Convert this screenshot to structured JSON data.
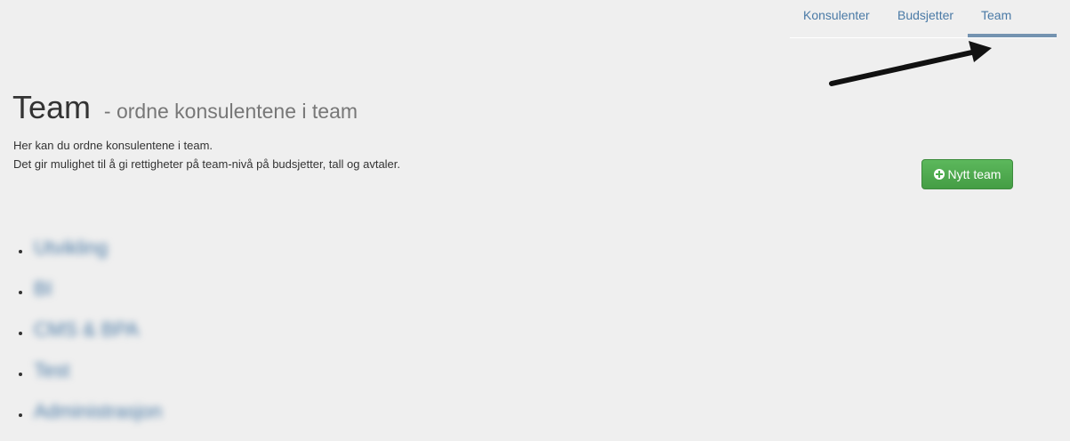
{
  "nav": {
    "tabs": [
      {
        "label": "Konsulenter",
        "active": false
      },
      {
        "label": "Budsjetter",
        "active": false
      },
      {
        "label": "Team",
        "active": true
      }
    ]
  },
  "header": {
    "title": "Team",
    "subtitle": "- ordne konsulentene i team"
  },
  "description": {
    "line1": "Her kan du ordne konsulentene i team.",
    "line2": "Det gir mulighet til å gi rettigheter på team-nivå på budsjetter, tall og avtaler."
  },
  "actions": {
    "new_team_label": "Nytt team",
    "new_team_icon": "plus-circle-icon"
  },
  "teams": [
    {
      "name": "Utvikling"
    },
    {
      "name": "BI"
    },
    {
      "name": "CMS & BPA"
    },
    {
      "name": "Test"
    },
    {
      "name": "Administrasjon"
    }
  ],
  "colors": {
    "accent": "#4a7aa6",
    "tab_underline": "#7493b0",
    "button_green": "#4cae4c",
    "background": "#efefef",
    "arrow": "#111111"
  }
}
